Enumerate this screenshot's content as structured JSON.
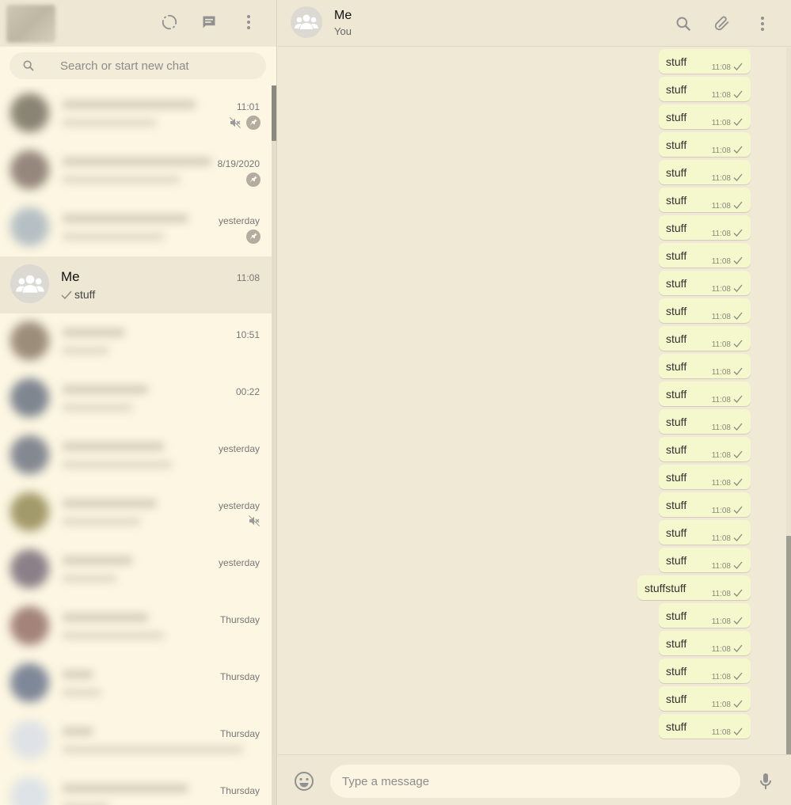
{
  "sidebar": {
    "search_placeholder": "Search or start new chat",
    "chats": [
      {
        "time": "11:01",
        "muted": true,
        "pinned": true,
        "blurred": true,
        "avatar_color": "#8a8474"
      },
      {
        "time": "8/19/2020",
        "muted": false,
        "pinned": true,
        "blurred": true,
        "avatar_color": "#95877c"
      },
      {
        "time": "yesterday",
        "muted": false,
        "pinned": true,
        "blurred": true,
        "avatar_color": "#b6c0c4"
      },
      {
        "time": "11:08",
        "name": "Me",
        "preview": "stuff",
        "muted": false,
        "pinned": false,
        "blurred": false,
        "active": true
      },
      {
        "time": "10:51",
        "muted": false,
        "pinned": false,
        "blurred": true,
        "avatar_color": "#9c8d7a"
      },
      {
        "time": "00:22",
        "muted": false,
        "pinned": false,
        "blurred": true,
        "avatar_color": "#7f8690"
      },
      {
        "time": "yesterday",
        "muted": false,
        "pinned": false,
        "blurred": true,
        "avatar_color": "#848891"
      },
      {
        "time": "yesterday",
        "muted": true,
        "pinned": false,
        "blurred": true,
        "avatar_color": "#a39a6a"
      },
      {
        "time": "yesterday",
        "muted": false,
        "pinned": false,
        "blurred": true,
        "avatar_color": "#8c8088"
      },
      {
        "time": "Thursday",
        "muted": false,
        "pinned": false,
        "blurred": true,
        "avatar_color": "#a3837a"
      },
      {
        "time": "Thursday",
        "muted": false,
        "pinned": false,
        "blurred": true,
        "avatar_color": "#7f8898"
      },
      {
        "time": "Thursday",
        "muted": false,
        "pinned": false,
        "blurred": true,
        "avatar_color": "#dfe2e6"
      },
      {
        "time": "Thursday",
        "muted": false,
        "pinned": false,
        "blurred": true,
        "avatar_color": "#dde3e6",
        "snippet": "web"
      }
    ]
  },
  "conversation": {
    "name": "Me",
    "subtitle": "You",
    "messages": [
      {
        "text": "stuff",
        "time": "11:08"
      },
      {
        "text": "stuff",
        "time": "11:08"
      },
      {
        "text": "stuff",
        "time": "11:08"
      },
      {
        "text": "stuff",
        "time": "11:08"
      },
      {
        "text": "stuff",
        "time": "11:08"
      },
      {
        "text": "stuff",
        "time": "11:08"
      },
      {
        "text": "stuff",
        "time": "11:08"
      },
      {
        "text": "stuff",
        "time": "11:08"
      },
      {
        "text": "stuff",
        "time": "11:08"
      },
      {
        "text": "stuff",
        "time": "11:08"
      },
      {
        "text": "stuff",
        "time": "11:08"
      },
      {
        "text": "stuff",
        "time": "11:08"
      },
      {
        "text": "stuff",
        "time": "11:08"
      },
      {
        "text": "stuff",
        "time": "11:08"
      },
      {
        "text": "stuff",
        "time": "11:08"
      },
      {
        "text": "stuff",
        "time": "11:08"
      },
      {
        "text": "stuff",
        "time": "11:08"
      },
      {
        "text": "stuff",
        "time": "11:08"
      },
      {
        "text": "stuff",
        "time": "11:08"
      },
      {
        "text": "stuffstuff",
        "time": "11:08"
      },
      {
        "text": "stuff",
        "time": "11:08"
      },
      {
        "text": "stuff",
        "time": "11:08"
      },
      {
        "text": "stuff",
        "time": "11:08"
      },
      {
        "text": "stuff",
        "time": "11:08"
      },
      {
        "text": "stuff",
        "time": "11:08"
      }
    ]
  },
  "composer": {
    "placeholder": "Type a message"
  },
  "icons": {
    "header": [
      "status-icon",
      "new-chat-icon",
      "menu-icon"
    ],
    "conversation_header": [
      "search-icon",
      "attach-icon",
      "menu-icon"
    ],
    "composer": [
      "emoji-icon",
      "mic-icon"
    ]
  },
  "colors": {
    "sidebar_bg": "#fcf6e2",
    "header_bg": "#ede7d3",
    "chat_bg": "#efe9d5",
    "outgoing_bubble": "#f5f8cd",
    "icon_gray": "#919191"
  }
}
